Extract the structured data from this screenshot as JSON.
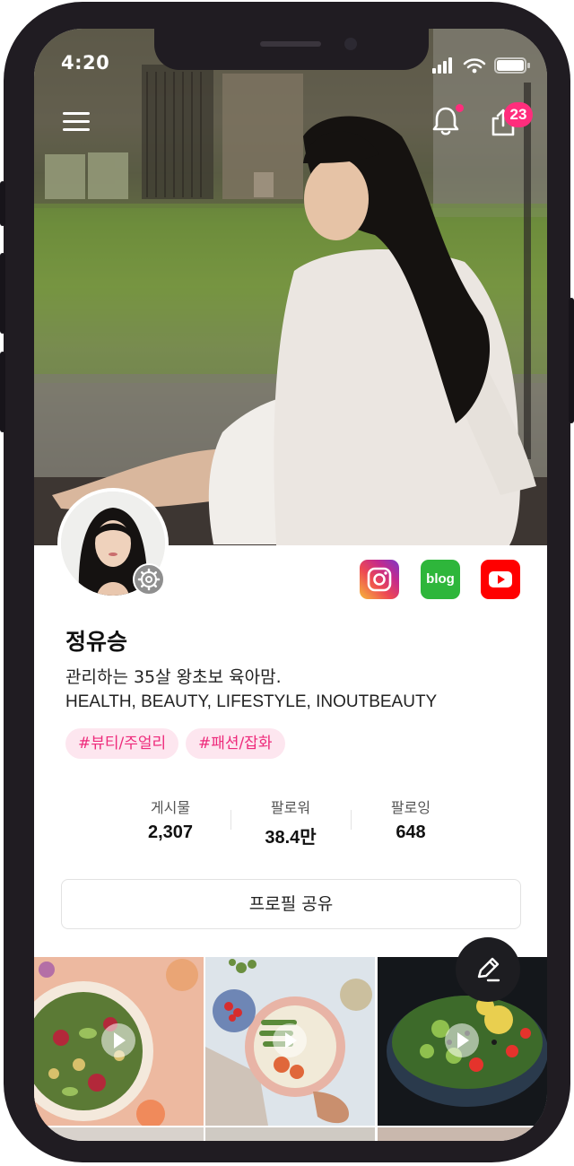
{
  "status_bar": {
    "time": "4:20"
  },
  "header": {
    "menu_icon": "hamburger-menu-icon",
    "notification_icon": "bell-icon",
    "share_icon": "share-upload-icon",
    "share_badge": "23"
  },
  "profile": {
    "name": "정유승",
    "bio_line1": "관리하는 35살 왕초보 육아맘.",
    "bio_line2": "HEALTH, BEAUTY, LIFESTYLE, INOUTBEAUTY",
    "tags": [
      "#뷰티/주얼리",
      "#패션/잡화"
    ],
    "sns": {
      "instagram_icon": "instagram-icon",
      "blog_label": "blog",
      "youtube_icon": "youtube-icon"
    }
  },
  "stats": [
    {
      "label": "게시물",
      "value": "2,307"
    },
    {
      "label": "팔로워",
      "value": "38.4만"
    },
    {
      "label": "팔로잉",
      "value": "648"
    }
  ],
  "share_button_label": "프로필 공유",
  "fab_icon": "pencil-edit-icon",
  "colors": {
    "accent": "#ff2d7c",
    "tag_bg": "#fde6ef",
    "tag_text": "#ee2a7b",
    "fab_bg": "#1d1d21"
  }
}
